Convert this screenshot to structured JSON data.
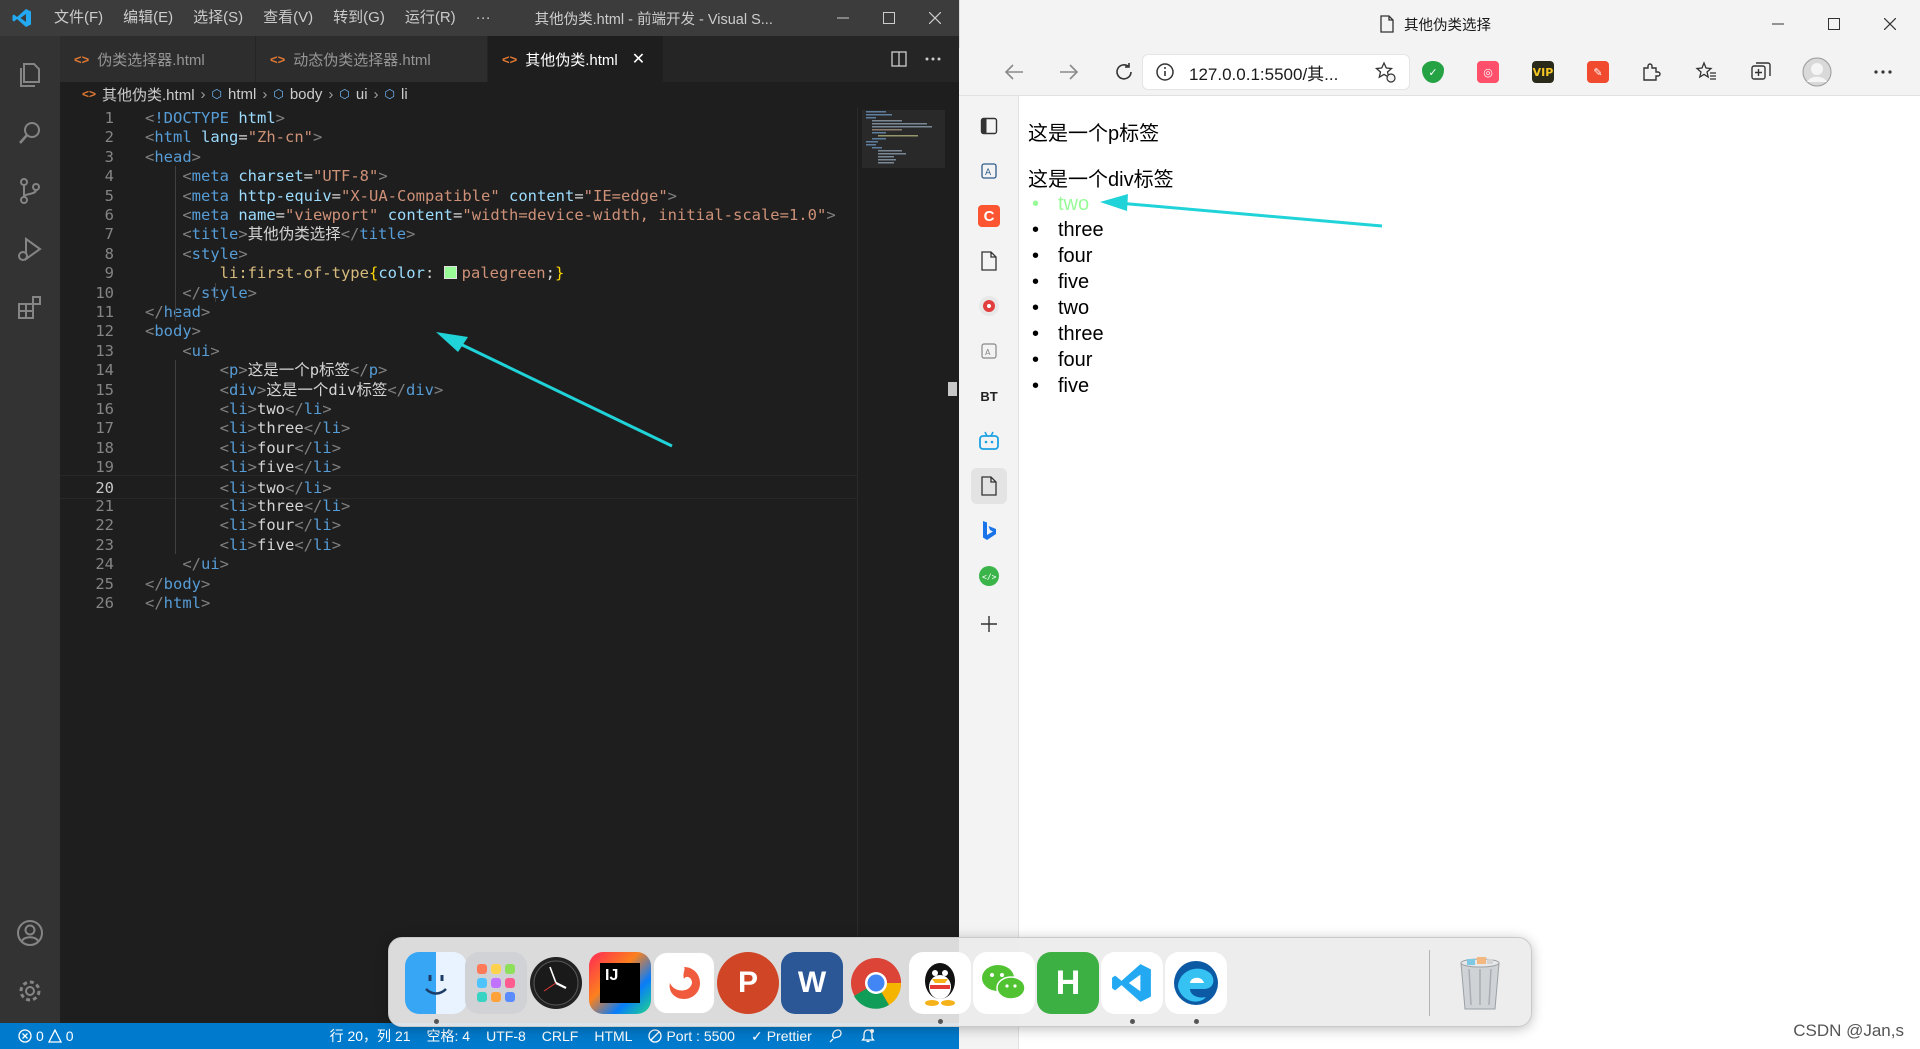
{
  "vscode": {
    "menus": [
      "文件(F)",
      "编辑(E)",
      "选择(S)",
      "查看(V)",
      "转到(G)",
      "运行(R)",
      "···"
    ],
    "window_title": "其他伪类.html - 前端开发 - Visual S...",
    "tabs": [
      {
        "label": "伪类选择器.html",
        "active": false
      },
      {
        "label": "动态伪类选择器.html",
        "active": false
      },
      {
        "label": "其他伪类.html",
        "active": true
      }
    ],
    "tab_close": "✕",
    "breadcrumb": [
      "其他伪类.html",
      "html",
      "body",
      "ui",
      "li"
    ],
    "code_lines": [
      "<!DOCTYPE html>",
      "<html lang=\"Zh-cn\">",
      "<head>",
      "    <meta charset=\"UTF-8\">",
      "    <meta http-equiv=\"X-UA-Compatible\" content=\"IE=edge\">",
      "    <meta name=\"viewport\" content=\"width=device-width, initial-scale=1.0\">",
      "    <title>其他伪类选择</title>",
      "    <style>",
      "        li:first-of-type{color: palegreen;}",
      "    </style>",
      "</head>",
      "<body>",
      "    <ui>",
      "        <p>这是一个p标签</p>",
      "        <div>这是一个div标签</div>",
      "        <li>two</li>",
      "        <li>three</li>",
      "        <li>four</li>",
      "        <li>five</li>",
      "        <li>two</li>",
      "        <li>three</li>",
      "        <li>four</li>",
      "        <li>five</li>",
      "    </ui>",
      "</body>",
      "</html>"
    ],
    "current_line": 20,
    "swatch_color": "#98fb98",
    "statusbar": {
      "errors": "0",
      "warnings": "0",
      "position": "行 20，列 21",
      "spaces": "空格: 4",
      "encoding": "UTF-8",
      "eol": "CRLF",
      "language": "HTML",
      "port": "Port : 5500",
      "prettier": "Prettier"
    }
  },
  "browser": {
    "tab_title": "其他伪类选择",
    "address": "127.0.0.1:5500/其...",
    "page": {
      "p_text": "这是一个p标签",
      "div_text": "这是一个div标签",
      "list_items": [
        "two",
        "three",
        "four",
        "five",
        "two",
        "three",
        "four",
        "five"
      ],
      "first_item_color": "#98fb98"
    },
    "sidebar_bt_label": "BT"
  },
  "dock": {
    "apps": [
      "finder-icon",
      "launchpad-icon",
      "clock-icon",
      "intellij-icon",
      "swift-icon",
      "powerpoint-icon",
      "word-icon",
      "chrome-icon",
      "qq-icon",
      "wechat-icon",
      "hbuilder-icon",
      "vscode-icon",
      "edge-icon",
      "trash-icon"
    ],
    "labels": {
      "intellij": "IJ",
      "powerpoint": "P",
      "word": "W",
      "hbuilder": "H"
    }
  },
  "watermark": "CSDN @Jan,s",
  "colors": {
    "accent_arrow": "#1fd3d8",
    "vscode_status": "#007acc"
  }
}
